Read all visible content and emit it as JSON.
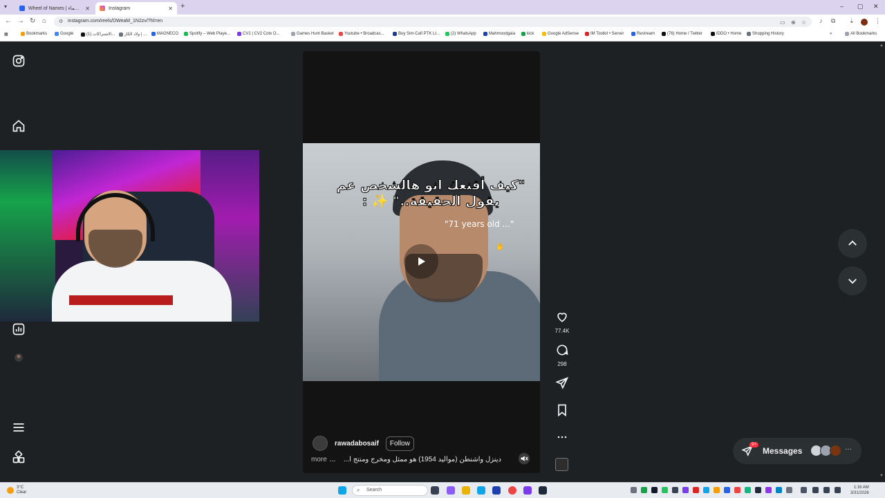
{
  "browser": {
    "tabs": [
      {
        "title": "Wheel of Names | تحدي الأسماء...",
        "active": false,
        "favicon_color": "#2563eb"
      },
      {
        "title": "Instagram",
        "active": true,
        "favicon_color": "#d946ef"
      }
    ],
    "new_tab": "+",
    "url": "instagram.com/reels/DWeaM_1N2zv/?hl=en",
    "window_controls": [
      "–",
      "▢",
      "✕"
    ],
    "bookmarks": [
      {
        "label": "Bookmarks",
        "color": "#f59e0b"
      },
      {
        "label": "Google",
        "color": "#4285f4"
      },
      {
        "label": "الاشتراكات (1)...",
        "color": "#111111"
      },
      {
        "label": "ولاد الكار | ...",
        "color": "#6b7280"
      },
      {
        "label": "MAGNECO",
        "color": "#2563eb"
      },
      {
        "label": "Spotify – Web Playe...",
        "color": "#1db954"
      },
      {
        "label": "CV2 | CV2 Cotx O...",
        "color": "#7c3aed"
      },
      {
        "label": "Games Hunt Basket",
        "color": "#9ca3af"
      },
      {
        "label": "Youtube • Broadcas...",
        "color": "#ef4444"
      },
      {
        "label": "Buy Sim-Cafi PTK Lt...",
        "color": "#1e3a8a"
      },
      {
        "label": "(2) WhatsApp",
        "color": "#22c55e"
      },
      {
        "label": "Mahmoodgaia",
        "color": "#1e40af"
      },
      {
        "label": "kick",
        "color": "#16a34a"
      },
      {
        "label": "Google AdSense",
        "color": "#fbbc05"
      },
      {
        "label": "IM Toolkit • Server",
        "color": "#dc2626"
      },
      {
        "label": "Restream",
        "color": "#2563eb"
      },
      {
        "label": "(76) Home / Twitter",
        "color": "#111111"
      },
      {
        "label": "IDDO • Home",
        "color": "#111111"
      },
      {
        "label": "Shopping History",
        "color": "#6b7280"
      }
    ],
    "all_bookmarks": "All Bookmarks"
  },
  "instagram": {
    "reel": {
      "overlay_text_ar": "\"كيف أقنعك انو هالشخص عم يقول الحقيقة..\" ✨ :",
      "overlay_text_en": "\"71 years old ...\"",
      "author": "rawadabosaif",
      "follow_label": "Follow",
      "caption": "دينزل واشنطن (مواليد 1954) هو ممثل ومخرج ومنتج أ...",
      "more_label": "more"
    },
    "actions": {
      "likes": "77.4K",
      "comments": "298"
    },
    "messages": {
      "label": "Messages",
      "badge": "9+"
    }
  },
  "taskbar": {
    "weather_temp": "3°C",
    "weather_desc": "Clear",
    "search_placeholder": "Search",
    "time": "1:16 AM",
    "date": "3/31/2026"
  }
}
